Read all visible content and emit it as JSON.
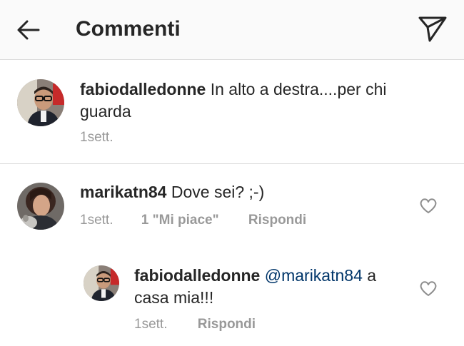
{
  "header": {
    "title": "Commenti",
    "back_icon": "arrow-left-icon",
    "send_icon": "paper-plane-icon"
  },
  "caption": {
    "username": "fabiodalledonne",
    "text": "In alto a destra....per chi",
    "text_line2": "guarda",
    "time": "1sett."
  },
  "comments": [
    {
      "username": "marikatn84",
      "text": "Dove sei? ;-)",
      "time": "1sett.",
      "likes": "1 \"Mi piace\"",
      "reply_label": "Rispondi"
    },
    {
      "username": "fabiodalledonne",
      "mention": "@marikatn84",
      "text": "a",
      "text_line2": "casa mia!!!",
      "time": "1sett.",
      "reply_label": "Rispondi"
    }
  ],
  "colors": {
    "text": "#262626",
    "meta": "#999999",
    "mention": "#003569",
    "divider": "#dbdbdb",
    "header_bg": "#fafafa"
  }
}
